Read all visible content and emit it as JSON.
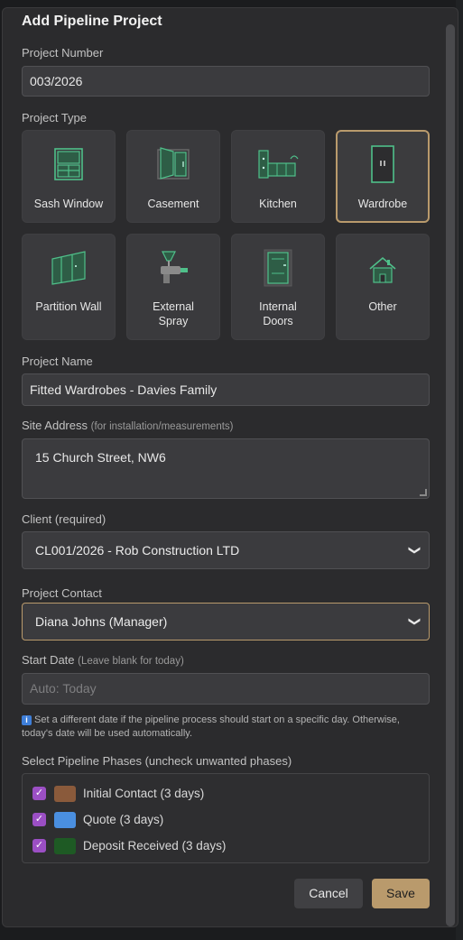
{
  "modal": {
    "title": "Add Pipeline Project"
  },
  "project_number": {
    "label": "Project Number",
    "value": "003/2026"
  },
  "project_type": {
    "label": "Project Type",
    "options": [
      {
        "label": "Sash Window",
        "icon": "sash-window-icon",
        "selected": false
      },
      {
        "label": "Casement",
        "icon": "casement-icon",
        "selected": false
      },
      {
        "label": "Kitchen",
        "icon": "kitchen-icon",
        "selected": false
      },
      {
        "label": "Wardrobe",
        "icon": "wardrobe-icon",
        "selected": true
      },
      {
        "label": "Partition Wall",
        "icon": "partition-wall-icon",
        "selected": false
      },
      {
        "label": "External Spray",
        "line1": "External",
        "line2": "Spray",
        "icon": "spray-gun-icon",
        "selected": false
      },
      {
        "label": "Internal Doors",
        "line1": "Internal",
        "line2": "Doors",
        "icon": "internal-door-icon",
        "selected": false
      },
      {
        "label": "Other",
        "icon": "house-icon",
        "selected": false
      }
    ]
  },
  "project_name": {
    "label": "Project Name",
    "value": "Fitted Wardrobes - Davies Family"
  },
  "site_address": {
    "label": "Site Address",
    "hint": "(for installation/measurements)",
    "value": "15 Church Street, NW6"
  },
  "client": {
    "label": "Client (required)",
    "selected": "CL001/2026 - Rob Construction LTD"
  },
  "project_contact": {
    "label": "Project Contact",
    "selected": "Diana Johns (Manager)"
  },
  "start_date": {
    "label": "Start Date",
    "hint": "(Leave blank for today)",
    "placeholder": "Auto: Today",
    "info_line1": "Set a different date if the pipeline process should start on a specific day. Otherwise,",
    "info_line2": "today's date will be used automatically."
  },
  "phases": {
    "label": "Select Pipeline Phases (uncheck unwanted phases)",
    "items": [
      {
        "label": "Initial Contact (3 days)",
        "color": "#8a5a3b",
        "checked": true
      },
      {
        "label": "Quote (3 days)",
        "color": "#4a8fe0",
        "checked": true
      },
      {
        "label": "Deposit Received (3 days)",
        "color": "#1e5a24",
        "checked": true
      }
    ]
  },
  "actions": {
    "cancel_label": "Cancel",
    "save_label": "Save"
  },
  "colors": {
    "accent": "#b99a6c",
    "checkbox": "#9b4fc4",
    "icon_green": "#4fc08a"
  }
}
